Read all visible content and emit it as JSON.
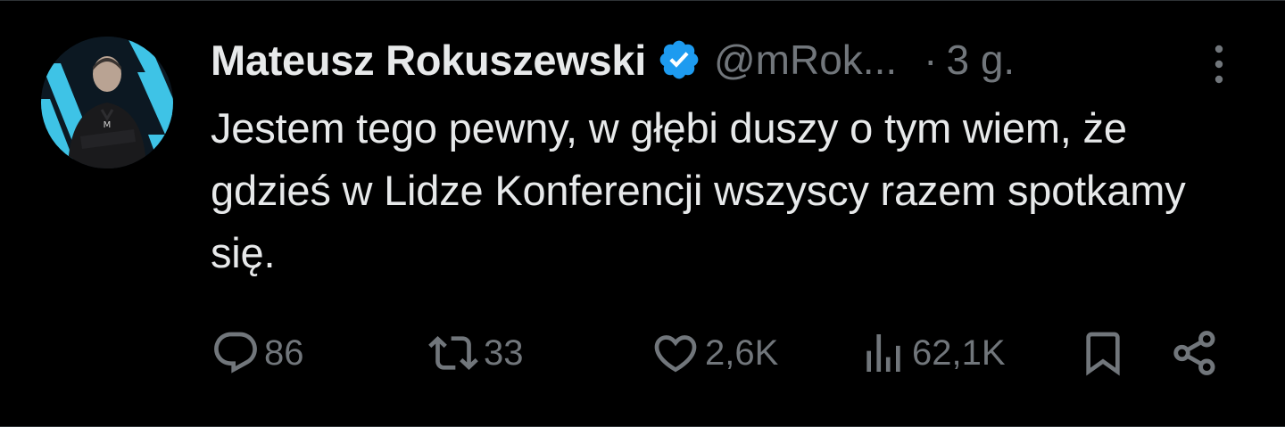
{
  "tweet": {
    "author_name": "Mateusz Rokuszewski",
    "handle": "@mRok...",
    "dot": "·",
    "time": "3 g.",
    "text": "Jestem tego pewny, w głębi duszy o tym wiem, że gdzieś w Lidze Konferencji wszyscy razem spotkamy się.",
    "verified": true
  },
  "actions": {
    "replies": "86",
    "retweets": "33",
    "likes": "2,6K",
    "views": "62,1K"
  },
  "colors": {
    "background": "#000000",
    "text_primary": "#e7e9ea",
    "text_secondary": "#71767b",
    "verified_blue": "#1d9bf0",
    "divider": "#2f3336"
  },
  "icons": {
    "verified": "verified-badge-icon",
    "more": "more-vertical-icon",
    "reply": "reply-icon",
    "retweet": "retweet-icon",
    "like": "heart-icon",
    "views": "views-icon",
    "bookmark": "bookmark-icon",
    "share": "share-icon"
  }
}
